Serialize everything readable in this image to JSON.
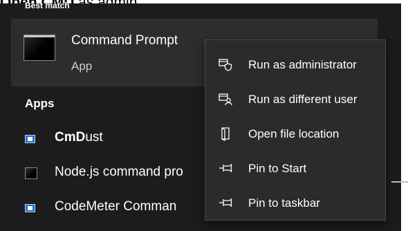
{
  "caption": {
    "bold_text": "Open CMD",
    "rest_text": " as admin."
  },
  "start_menu": {
    "best_match_label": "Best match",
    "best_match": {
      "icon": "command-prompt-icon",
      "title": "Command Prompt",
      "subtitle": "App"
    },
    "apps_label": "Apps",
    "apps": [
      {
        "icon": "cmdust-icon",
        "bold": "CmD",
        "rest": "ust"
      },
      {
        "icon": "nodejs-cmd-icon",
        "bold": "",
        "rest": "Node.js command pro"
      },
      {
        "icon": "codemeter-icon",
        "bold": "",
        "rest": "CodeMeter Comman"
      }
    ]
  },
  "context_menu": {
    "items": [
      {
        "icon": "shield-icon",
        "label": "Run as administrator"
      },
      {
        "icon": "user-switch-icon",
        "label": "Run as different user"
      },
      {
        "icon": "file-location-icon",
        "label": "Open file location"
      },
      {
        "icon": "pin-icon",
        "label": "Pin to Start"
      },
      {
        "icon": "pin-icon",
        "label": "Pin to taskbar"
      }
    ]
  },
  "colors": {
    "panel_bg": "#1c1c1c",
    "selected_row_bg": "#2d2d2d",
    "menu_bg": "#2b2b2b",
    "text": "#ffffff",
    "accent_icon": "#1e6fd9"
  }
}
